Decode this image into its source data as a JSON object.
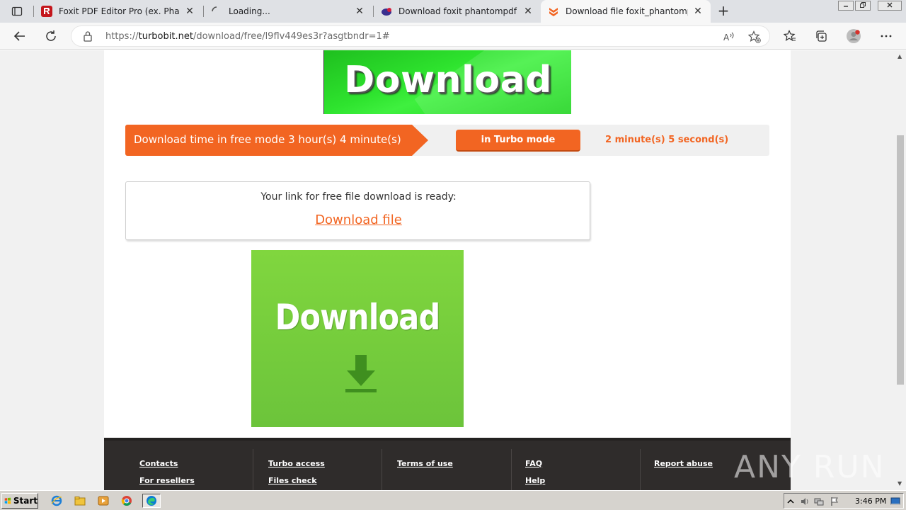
{
  "browser": {
    "tabs": [
      {
        "title": "Foxit PDF Editor Pro (ex. Phantom",
        "close": "✕"
      },
      {
        "title": "Loading...",
        "close": "✕"
      },
      {
        "title": "Download foxit phantompdf busi",
        "close": "✕"
      },
      {
        "title": "Download file foxit_phantompdf_",
        "close": "✕"
      }
    ],
    "new_tab": "+",
    "url_prefix": "https://",
    "url_domain": "turbobit.net",
    "url_path": "/download/free/l9flv449es3r?asgtbndr=1#"
  },
  "page": {
    "top_banner_text": "Download",
    "free_mode_text": "Download time in free mode 3 hour(s) 4 minute(s)",
    "turbo_button": "in Turbo mode",
    "turbo_time": "2 minute(s) 5 second(s)",
    "link_ready_text": "Your link for free file download is ready:",
    "download_link": "Download file",
    "big_banner_text": "Download",
    "footer": {
      "col1": [
        "Contacts",
        "For resellers"
      ],
      "col2": [
        "Turbo access",
        "Files check"
      ],
      "col3": [
        "Terms of use"
      ],
      "col4": [
        "FAQ",
        "Help"
      ],
      "col5": [
        "Report abuse"
      ]
    },
    "watermark": "ANY RUN"
  },
  "taskbar": {
    "start": "Start",
    "clock": "3:46 PM"
  },
  "colors": {
    "accent": "#f26522",
    "green_banner": "#2ee32e",
    "footer_bg": "#2f2c2b"
  }
}
